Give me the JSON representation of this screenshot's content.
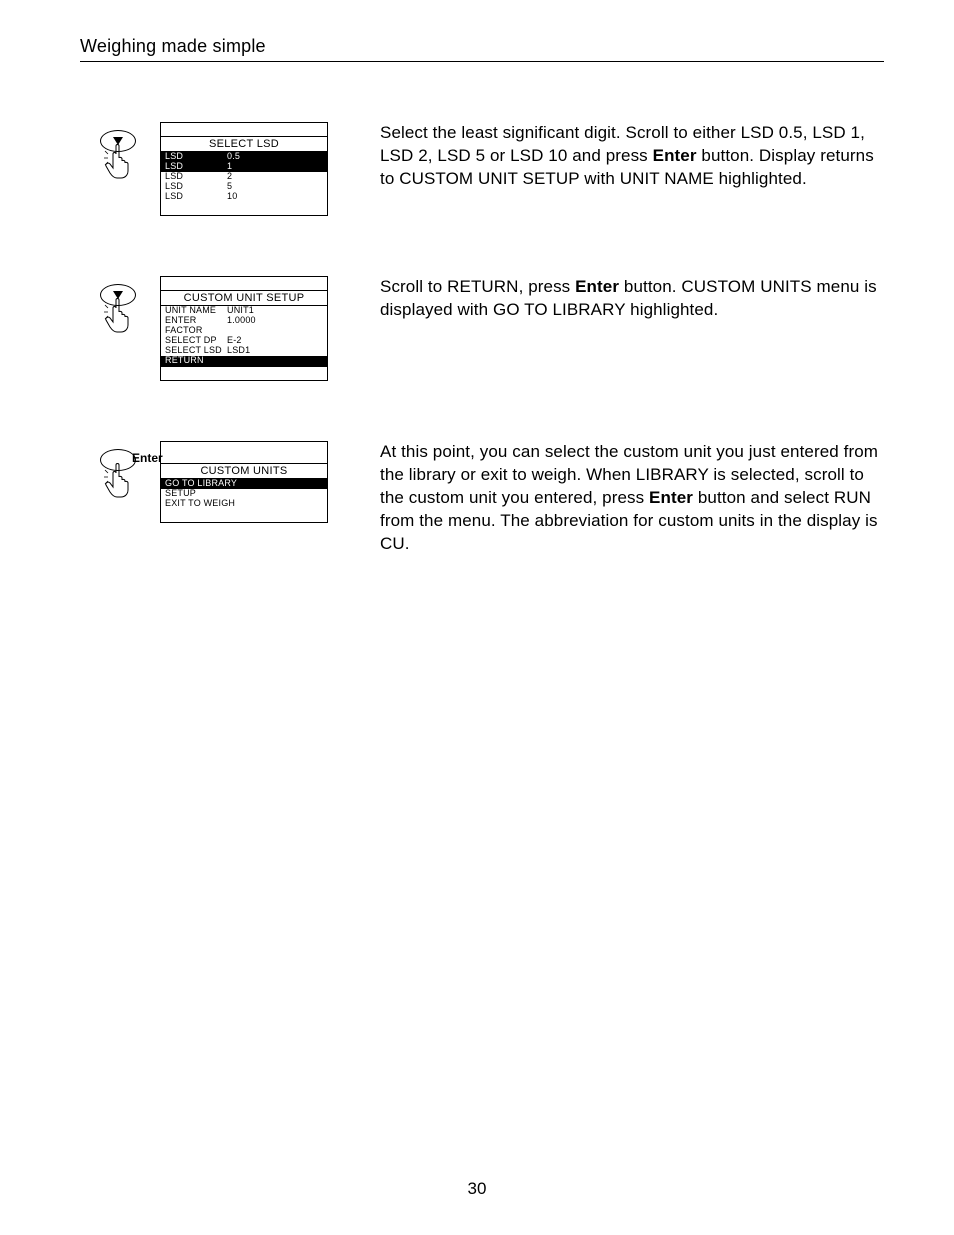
{
  "header": {
    "title": "Weighing made simple"
  },
  "page_number": "30",
  "section1": {
    "screen_title": "SELECT LSD",
    "rows": [
      {
        "c1": "LSD",
        "c2": "0.5",
        "hl": true
      },
      {
        "c1": "LSD",
        "c2": "1",
        "hl": true
      },
      {
        "c1": "LSD",
        "c2": "2",
        "hl": false
      },
      {
        "c1": "LSD",
        "c2": "5",
        "hl": false
      },
      {
        "c1": "LSD",
        "c2": "10",
        "hl": false
      }
    ],
    "text_pre": "Select the least significant digit.  Scroll to either LSD 0.5, LSD 1, LSD 2, LSD 5 or LSD 10 and press ",
    "text_bold": "Enter",
    "text_post": " button.  Display returns to CUSTOM UNIT SETUP with UNIT NAME highlighted."
  },
  "section2": {
    "screen_title": "CUSTOM UNIT SETUP",
    "rows": [
      {
        "c1": "UNIT NAME",
        "c2": "UNIT1",
        "hl": false
      },
      {
        "c1": "ENTER FACTOR",
        "c2": "1.0000",
        "hl": false
      },
      {
        "c1": "SELECT DP",
        "c2": "E-2",
        "hl": false
      },
      {
        "c1": "SELECT LSD",
        "c2": "LSD1",
        "hl": false
      }
    ],
    "return_label": "RETURN",
    "text_pre": "Scroll to RETURN, press ",
    "text_bold": "Enter",
    "text_post": " button.  CUSTOM UNITS menu is displayed with GO TO LIBRARY highlighted."
  },
  "section3": {
    "enter_label": "Enter",
    "screen_title": "CUSTOM UNITS",
    "rows": [
      {
        "label": "GO TO LIBRARY",
        "hl": true
      },
      {
        "label": "SETUP",
        "hl": false
      },
      {
        "label": "EXIT TO WEIGH",
        "hl": false
      }
    ],
    "text_pre": "At this point, you can select the custom unit you just entered from the library or exit to weigh.  When LIBRARY is selected, scroll to the custom unit you entered, press ",
    "text_bold": "Enter",
    "text_post": " button and select RUN from the menu.  The abbreviation for custom units in the display is CU."
  }
}
